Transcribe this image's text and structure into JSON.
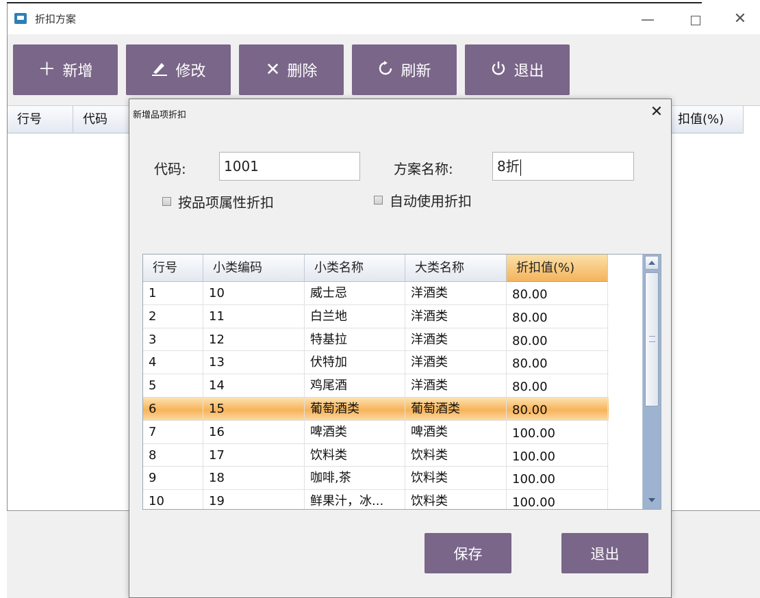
{
  "window": {
    "title": "折扣方案",
    "controls": {
      "minimize": "—",
      "maximize": "□",
      "close": "✕"
    }
  },
  "toolbar": {
    "buttons": [
      {
        "label": "新增",
        "icon": "plus-icon"
      },
      {
        "label": "修改",
        "icon": "pencil-icon"
      },
      {
        "label": "删除",
        "icon": "x-icon"
      },
      {
        "label": "刷新",
        "icon": "refresh-icon"
      },
      {
        "label": "退出",
        "icon": "power-icon"
      }
    ]
  },
  "main_table": {
    "headers": [
      "行号",
      "代码"
    ],
    "tail_header": "扣值(%)"
  },
  "dialog": {
    "title": "新增品项折扣",
    "close": "✕",
    "code_label": "代码:",
    "code_value": "1001",
    "name_label": "方案名称:",
    "name_value": "8折",
    "checkbox_attr": "按品项属性折扣",
    "checkbox_auto": "自动使用折扣",
    "grid": {
      "headers": [
        "行号",
        "小类编码",
        "小类名称",
        "大类名称",
        "折扣值(%)"
      ],
      "active_header": 4,
      "selected_row": 5,
      "rows": [
        [
          "1",
          "10",
          "威士忌",
          "洋酒类",
          "80.00"
        ],
        [
          "2",
          "11",
          "白兰地",
          "洋酒类",
          "80.00"
        ],
        [
          "3",
          "12",
          "特基拉",
          "洋酒类",
          "80.00"
        ],
        [
          "4",
          "13",
          "伏特加",
          "洋酒类",
          "80.00"
        ],
        [
          "5",
          "14",
          "鸡尾酒",
          "洋酒类",
          "80.00"
        ],
        [
          "6",
          "15",
          "葡萄酒类",
          "葡萄酒类",
          "80.00"
        ],
        [
          "7",
          "16",
          "啤酒类",
          "啤酒类",
          "100.00"
        ],
        [
          "8",
          "17",
          "饮料类",
          "饮料类",
          "100.00"
        ],
        [
          "9",
          "18",
          "咖啡,茶",
          "饮料类",
          "100.00"
        ],
        [
          "10",
          "19",
          "鲜果汁，冰...",
          "饮料类",
          "100.00"
        ]
      ]
    },
    "save_label": "保存",
    "quit_label": "退出"
  },
  "colors": {
    "button_bg": "#7a6689",
    "selection": "#f7b35a",
    "header_active": "#f4b45c"
  }
}
